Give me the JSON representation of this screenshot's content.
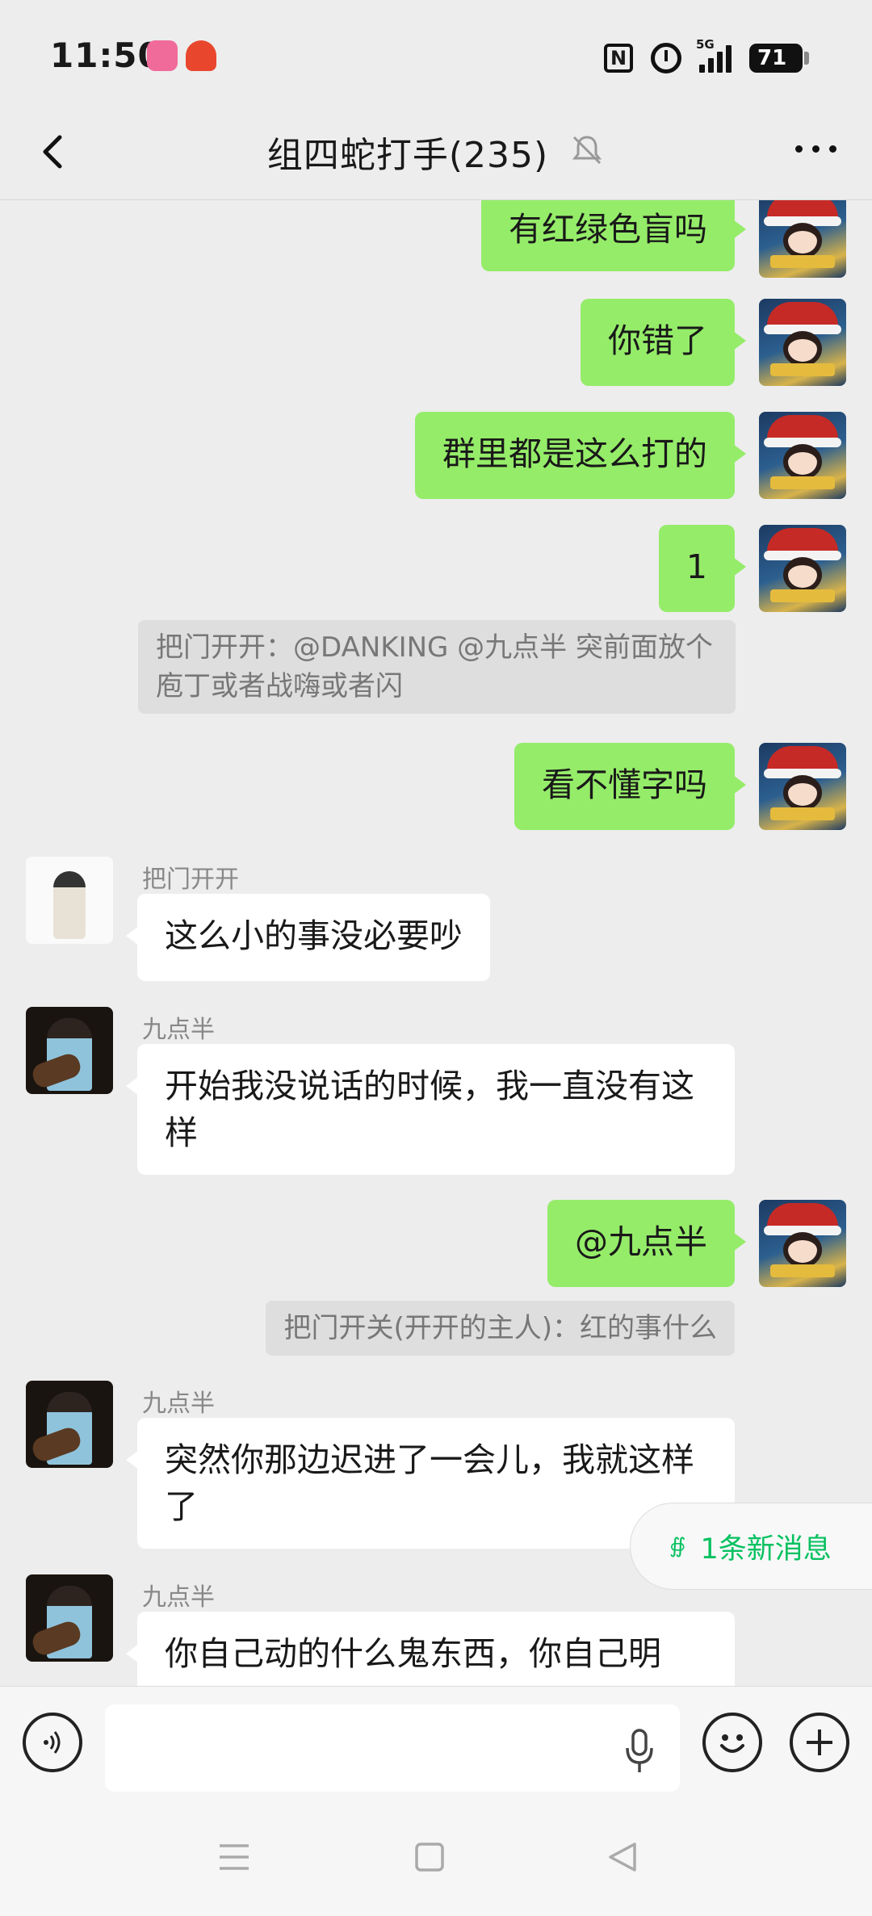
{
  "status_bar": {
    "time": "11:50",
    "network": "5G",
    "battery": "71",
    "icons": [
      "bilibili-app-icon",
      "app-icon",
      "nfc-icon",
      "alarm-icon",
      "signal-icon",
      "battery-icon"
    ]
  },
  "header": {
    "title": "组四蛇打手(235)",
    "icons": [
      "back-icon",
      "mute-icon",
      "more-icon"
    ]
  },
  "messages": [
    {
      "side": "out",
      "text": "有红绿色盲吗"
    },
    {
      "side": "out",
      "text": "你错了"
    },
    {
      "side": "out",
      "text": "群里都是这么打的"
    },
    {
      "side": "out",
      "text": "1"
    },
    {
      "side": "quote",
      "text": "把门开开：@DANKING @九点半 突前面放个庖丁或者战嗨或者闪"
    },
    {
      "side": "out",
      "text": "看不懂字吗"
    },
    {
      "side": "in",
      "sender": "把门开开",
      "text": "这么小的事没必要吵"
    },
    {
      "side": "in",
      "sender": "九点半",
      "text": "开始我没说话的时候，我一直没有这样"
    },
    {
      "side": "out",
      "text": "@九点半"
    },
    {
      "side": "quote",
      "text": "把门开关(开开的主人)：红的事什么"
    },
    {
      "side": "in",
      "sender": "九点半",
      "text": "突然你那边迟进了一会儿，我就这样了"
    },
    {
      "side": "in",
      "sender": "九点半",
      "text": "你自己动的什么鬼东西，你自己明"
    }
  ],
  "new_message_pill": {
    "label": "1条新消息",
    "icon": "double-chevron-down-icon"
  },
  "input_bar": {
    "placeholder": "",
    "icons": [
      "voice-icon",
      "mic-icon",
      "emoji-icon",
      "plus-icon"
    ]
  },
  "system_nav": {
    "icons": [
      "menu-icon",
      "home-icon",
      "back-triangle-icon"
    ]
  },
  "colors": {
    "background": "#ededed",
    "outgoing_bubble": "#95ec69",
    "incoming_bubble": "#ffffff",
    "quote_bg": "#dedede",
    "accent_green": "#07c160"
  }
}
